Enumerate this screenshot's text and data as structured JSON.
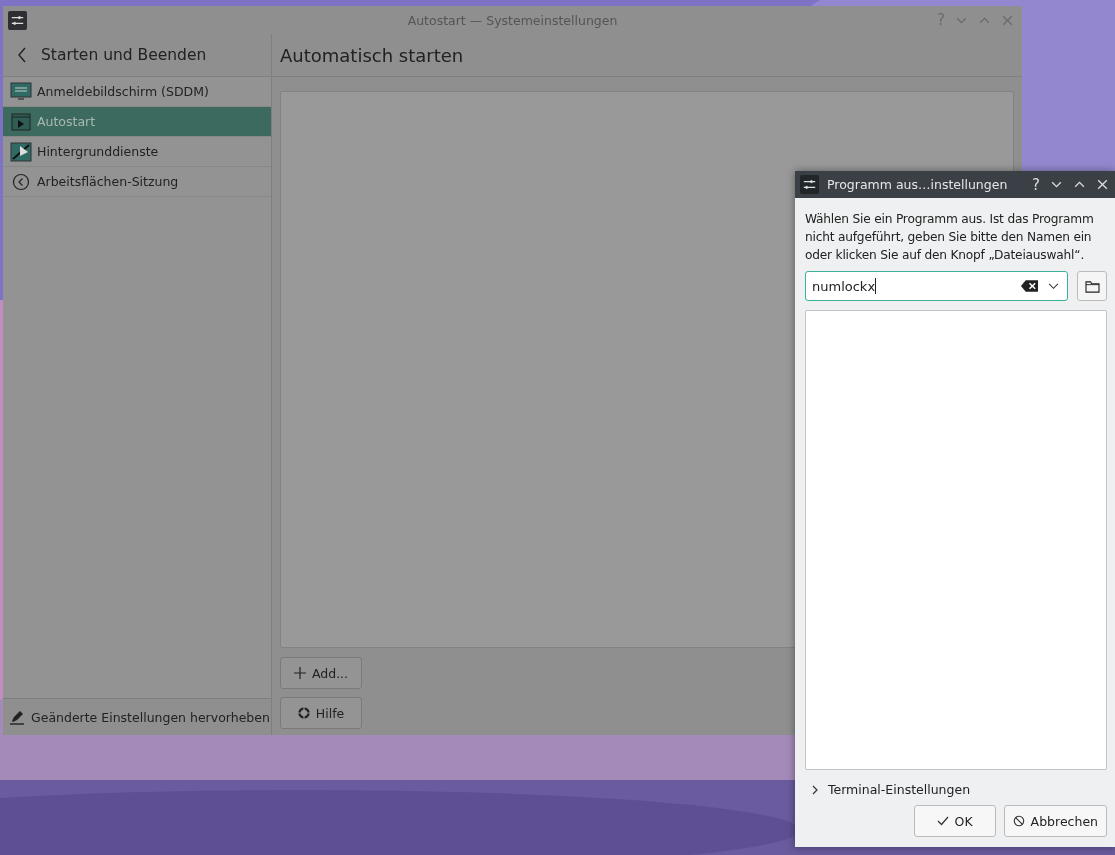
{
  "main_window": {
    "title": "Autostart — Systemeinstellungen",
    "help_button": "?",
    "sidebar": {
      "back_title": "Starten und Beenden",
      "items": [
        {
          "label": "Anmeldebildschirm (SDDM)",
          "selected": false
        },
        {
          "label": "Autostart",
          "selected": true
        },
        {
          "label": "Hintergrunddienste",
          "selected": false
        },
        {
          "label": "Arbeitsflächen-Sitzung",
          "selected": false
        }
      ],
      "footer": "Geänderte Einstellungen hervorheben"
    },
    "page": {
      "heading": "Automatisch starten",
      "add_button": "Add...",
      "help_button": "Hilfe"
    }
  },
  "dialog": {
    "title": "Programm aus…instellungen",
    "help_button": "?",
    "description": "Wählen Sie ein Programm aus. Ist das Programm nicht aufgeführt, geben Sie bitte den Namen ein oder klicken Sie auf den Knopf „Dateiauswahl“.",
    "command": {
      "value": "numlockx"
    },
    "terminal_section": {
      "label": "Terminal-Einstellungen",
      "expanded": false
    },
    "buttons": {
      "ok": "OK",
      "cancel": "Abbrechen"
    }
  }
}
